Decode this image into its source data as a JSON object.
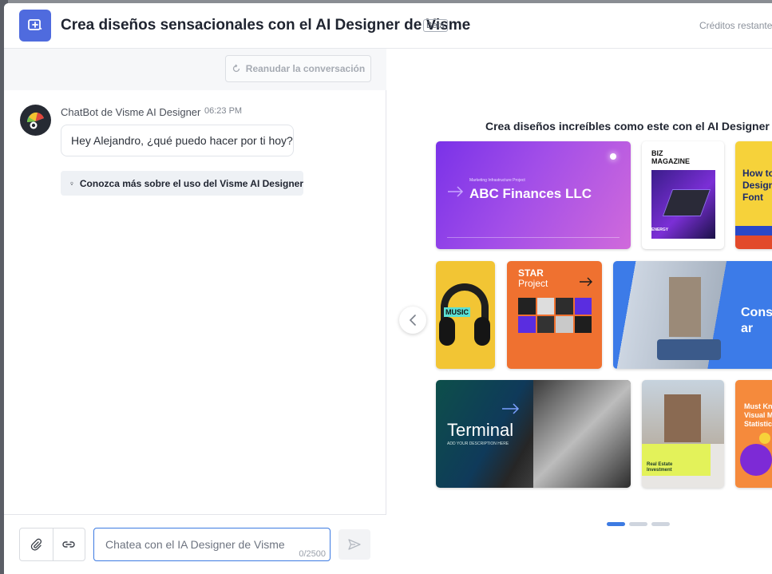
{
  "header": {
    "title": "Crea diseños sensacionales con el AI Designer de Visme",
    "badge": "Beta",
    "credits": "Créditos restante"
  },
  "chat": {
    "resume_label": "Reanudar la conversación",
    "bot_name": "ChatBot de Visme AI Designer",
    "time": "06:23 PM",
    "greeting": "Hey Alejandro, ¿qué puedo hacer por ti hoy?",
    "learn_more": "Conozca más sobre el uso del Visme AI Designer"
  },
  "composer": {
    "placeholder": "Chatea con el IA Designer de Visme",
    "counter": "0/2500"
  },
  "gallery": {
    "title": "Crea diseños increíbles como este con el AI Designer de Vi",
    "cards": {
      "abc_kicker": "Marketing Infrastructure Project",
      "abc_title": "ABC Finances LLC",
      "biz_title": "BIZ MAGAZINE",
      "biz_tag": "ENERGY",
      "howto_title": "How to Design a Font",
      "music_title": "MUSIC",
      "star_title": "STAR",
      "star_subtitle": "Project",
      "consulting_title": "Cons ar",
      "terminal_title": "Terminal",
      "terminal_subtitle": "ADD YOUR DESCRIPTION HERE",
      "realestate_title": "Real Estate Investment",
      "mustknow_title": "Must Kn Visual M Statistic"
    },
    "active_page": 1,
    "page_count": 3
  },
  "colors": {
    "accent": "#4f6bde",
    "focus": "#3d7be2"
  }
}
